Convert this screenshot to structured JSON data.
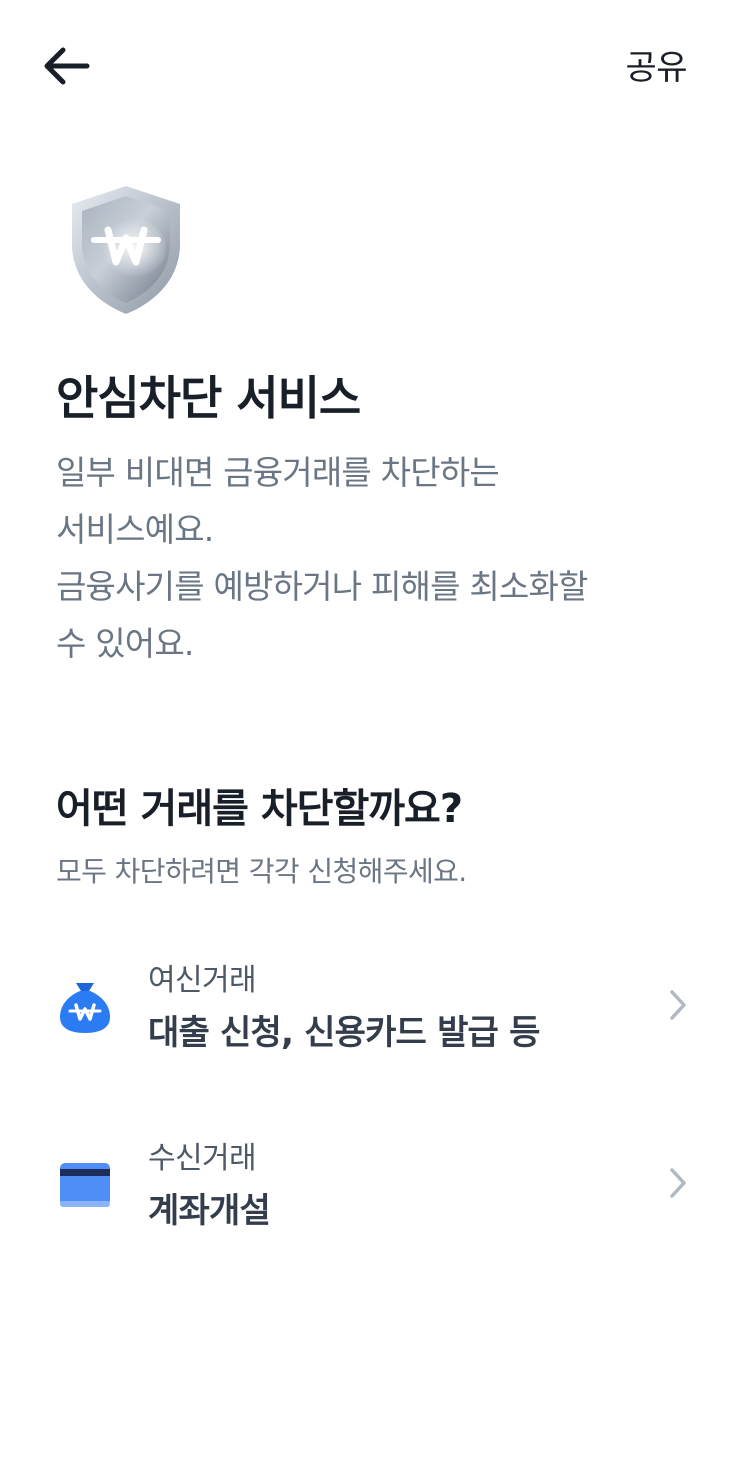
{
  "header": {
    "back_icon": "arrow-left-icon",
    "share_label": "공유"
  },
  "hero": {
    "icon": "shield-won-icon",
    "title": "안심차단 서비스",
    "description_lines": [
      "일부 비대면 금융거래를 차단하는",
      "서비스예요.",
      "금융사기를 예방하거나 피해를 최소화할",
      "수 있어요."
    ]
  },
  "section": {
    "title": "어떤 거래를 차단할까요?",
    "subtitle": "모두 차단하려면 각각 신청해주세요."
  },
  "options": [
    {
      "icon": "money-bag-icon",
      "label": "여신거래",
      "value": "대출 신청, 신용카드 발급 등"
    },
    {
      "icon": "card-icon",
      "label": "수신거래",
      "value": "계좌개설"
    }
  ],
  "colors": {
    "title": "#191f28",
    "body_text": "#6b7684",
    "accent_blue": "#1b64da",
    "card_blue": "#4f8ef7",
    "shield_silver": "#b0b8c1",
    "chevron": "#b0b8c1"
  }
}
